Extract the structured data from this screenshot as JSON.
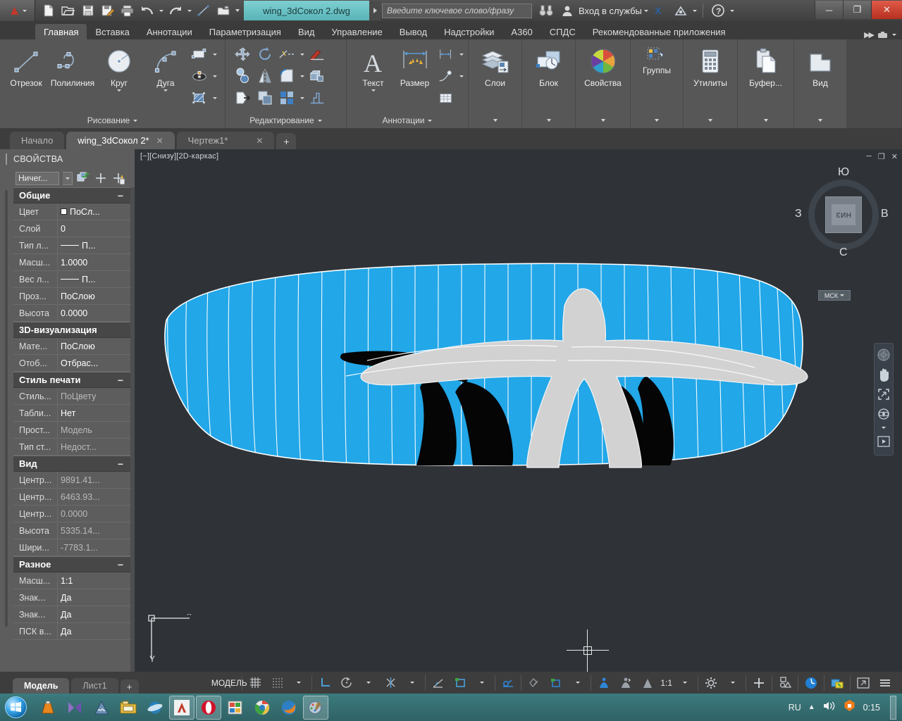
{
  "titlebar": {
    "app_logo": "autocad-a-logo",
    "quick_access": [
      {
        "name": "new-file-icon",
        "label": "Создать"
      },
      {
        "name": "open-folder-icon",
        "label": "Открыть"
      },
      {
        "name": "save-icon",
        "label": "Сохранить"
      },
      {
        "name": "save-as-icon",
        "label": "Сохранить как"
      },
      {
        "name": "print-icon",
        "label": "Печать"
      },
      {
        "name": "undo-icon",
        "label": "Отменить"
      },
      {
        "name": "redo-icon",
        "label": "Повторить"
      },
      {
        "name": "line-tool-icon",
        "label": "Отрезок"
      },
      {
        "name": "workspace-icon",
        "label": "Рабочее пространство"
      }
    ],
    "document_title": "wing_3dСокол 2.dwg",
    "search_placeholder": "Введите ключевое слово/фразу",
    "binoculars_icon": "binoculars-icon",
    "user_icon": "user-icon",
    "signin_label": "Вход в службы",
    "exchange_icon": "autodesk-exchange-icon",
    "a360_icon": "autodesk-a360-icon",
    "help_label": "?",
    "window_buttons": {
      "minimize": "─",
      "maximize": "❐",
      "close": "✕"
    }
  },
  "ribbon_tabs": [
    {
      "label": "Главная",
      "active": true
    },
    {
      "label": "Вставка",
      "active": false
    },
    {
      "label": "Аннотации",
      "active": false
    },
    {
      "label": "Параметризация",
      "active": false
    },
    {
      "label": "Вид",
      "active": false
    },
    {
      "label": "Управление",
      "active": false
    },
    {
      "label": "Вывод",
      "active": false
    },
    {
      "label": "Надстройки",
      "active": false
    },
    {
      "label": "A360",
      "active": false
    },
    {
      "label": "СПДС",
      "active": false
    },
    {
      "label": "Рекомендованные приложения",
      "active": false
    }
  ],
  "ribbon_panels": {
    "draw": {
      "title": "Рисование",
      "buttons": [
        {
          "label": "Отрезок",
          "icon": "line-icon",
          "dropdown": false
        },
        {
          "label": "Полилиния",
          "icon": "polyline-icon",
          "dropdown": false
        },
        {
          "label": "Круг",
          "icon": "circle-icon",
          "dropdown": true
        },
        {
          "label": "Дуга",
          "icon": "arc-icon",
          "dropdown": true
        }
      ],
      "small_buttons": [
        {
          "icon": "rectangle-icon",
          "dropdown": true
        },
        {
          "icon": "ellipse-icon",
          "dropdown": true
        },
        {
          "icon": "hatch-icon",
          "dropdown": true
        }
      ]
    },
    "modify": {
      "title": "Редактирование",
      "small_buttons": [
        {
          "icon": "move-icon",
          "dropdown": false
        },
        {
          "icon": "rotate-icon",
          "dropdown": false
        },
        {
          "icon": "trim-icon",
          "dropdown": true
        },
        {
          "icon": "match-properties-icon",
          "dropdown": false
        },
        {
          "icon": "copy-icon",
          "dropdown": false
        },
        {
          "icon": "mirror-icon",
          "dropdown": false
        },
        {
          "icon": "fillet-icon",
          "dropdown": true
        },
        {
          "icon": "3d-array-icon",
          "dropdown": false
        },
        {
          "icon": "stretch-icon",
          "dropdown": false
        },
        {
          "icon": "scale-icon",
          "dropdown": false
        },
        {
          "icon": "array-icon",
          "dropdown": true
        },
        {
          "icon": "extrude-icon",
          "dropdown": false
        }
      ]
    },
    "annotation": {
      "title": "Аннотации",
      "buttons": [
        {
          "label": "Текст",
          "icon": "text-a-icon",
          "dropdown": true
        },
        {
          "label": "Размер",
          "icon": "dimension-icon",
          "dropdown": false
        }
      ],
      "small_buttons": [
        {
          "icon": "dimension-linear-icon",
          "dropdown": true
        },
        {
          "icon": "leader-icon",
          "dropdown": true
        },
        {
          "icon": "table-icon",
          "dropdown": false
        }
      ]
    },
    "large_panels": [
      {
        "label": "Слои",
        "icon": "layers-icon",
        "title": ""
      },
      {
        "label": "Блок",
        "icon": "block-icon",
        "title": ""
      },
      {
        "label": "Свойства",
        "icon": "properties-wheel-icon",
        "title": ""
      },
      {
        "label": "Группы",
        "icon": "groups-icon",
        "title": ""
      },
      {
        "label": "Утилиты",
        "icon": "utilities-calculator-icon",
        "title": ""
      },
      {
        "label": "Буфер...",
        "icon": "clipboard-icon",
        "title": ""
      },
      {
        "label": "Вид",
        "icon": "view-icon",
        "title": ""
      }
    ]
  },
  "file_tabs": [
    {
      "label": "Начало",
      "active": false,
      "closable": false
    },
    {
      "label": "wing_3dСокол 2*",
      "active": true,
      "closable": true
    },
    {
      "label": "Чертеж1*",
      "active": false,
      "closable": true
    }
  ],
  "file_tab_add": "+",
  "properties": {
    "title": "СВОЙСТВА",
    "selection": "Ничег...",
    "toolbar_icons": [
      "quick-select-icon",
      "pick-point-icon",
      "quick-calc-icon"
    ],
    "groups": [
      {
        "name": "Общие",
        "collapse": "−",
        "rows": [
          {
            "key": "Цвет",
            "value": "ПоСл...",
            "swatch": true,
            "dim": false
          },
          {
            "key": "Слой",
            "value": "0",
            "dim": false
          },
          {
            "key": "Тип л...",
            "value": "П...",
            "linetype": true,
            "dim": false
          },
          {
            "key": "Масш...",
            "value": "1.0000",
            "dim": false
          },
          {
            "key": "Вес л...",
            "value": "П...",
            "linetype": true,
            "dim": false
          },
          {
            "key": "Проз...",
            "value": "ПоСлою",
            "dim": false
          },
          {
            "key": "Высота",
            "value": "0.0000",
            "dim": false
          }
        ]
      },
      {
        "name": "3D-визуализация",
        "collapse": "",
        "rows": [
          {
            "key": "Мате...",
            "value": "ПоСлою",
            "dim": false
          },
          {
            "key": "Отоб...",
            "value": "Отбрас...",
            "dim": false
          }
        ]
      },
      {
        "name": "Стиль печати",
        "collapse": "−",
        "rows": [
          {
            "key": "Стиль...",
            "value": "ПоЦвету",
            "dim": true
          },
          {
            "key": "Табли...",
            "value": "Нет",
            "dim": false
          },
          {
            "key": "Прост...",
            "value": "Модель",
            "dim": true
          },
          {
            "key": "Тип ст...",
            "value": "Недост...",
            "dim": true
          }
        ]
      },
      {
        "name": "Вид",
        "collapse": "−",
        "rows": [
          {
            "key": "Центр...",
            "value": "9891.41...",
            "dim": true
          },
          {
            "key": "Центр...",
            "value": "6463.93...",
            "dim": true
          },
          {
            "key": "Центр...",
            "value": "0.0000",
            "dim": true
          },
          {
            "key": "Высота",
            "value": "5335.14...",
            "dim": true
          },
          {
            "key": "Шири...",
            "value": "-7783.1...",
            "dim": true
          }
        ]
      },
      {
        "name": "Разное",
        "collapse": "−",
        "rows": [
          {
            "key": "Масш...",
            "value": "1:1",
            "dim": false
          },
          {
            "key": "Знак...",
            "value": "Да",
            "dim": false
          },
          {
            "key": "Знак...",
            "value": "Да",
            "dim": false
          },
          {
            "key": "ПСК в...",
            "value": "Да",
            "dim": false
          }
        ]
      }
    ]
  },
  "viewport": {
    "label": "[−][Снизу][2D-каркас]",
    "window_buttons": [
      "─",
      "❐",
      "✕"
    ],
    "viewcube": {
      "top": "Ю",
      "bottom": "С",
      "left": "З",
      "right": "В",
      "face": "НИЗ",
      "wcs": "МСК"
    },
    "navbar_icons": [
      "full-navigation-wheel-icon",
      "pan-hand-icon",
      "zoom-extents-icon",
      "orbit-icon",
      "show-motion-icon"
    ],
    "colors": {
      "background": "#2f3338",
      "wing_fill": "#22a7e8",
      "body_fill": "#d2d2d2",
      "shadow_fill": "#000000",
      "outline": "#ffffff"
    },
    "drawing_name": "wing-3d-falcon-plan-view"
  },
  "status_bar": {
    "model_tabs": [
      {
        "label": "Модель",
        "active": true
      },
      {
        "label": "Лист1",
        "active": false
      }
    ],
    "add_layout": "+",
    "space_label": "МОДЕЛЬ",
    "toggles": [
      {
        "name": "grid-display-icon",
        "dropdown": false
      },
      {
        "name": "snap-mode-icon",
        "dropdown": true
      },
      {
        "name": "ortho-mode-icon",
        "dropdown": false
      },
      {
        "name": "polar-tracking-icon",
        "dropdown": true
      },
      {
        "name": "object-snap-icon",
        "dropdown": true
      },
      {
        "name": "object-snap-tracking-icon",
        "dropdown": false
      },
      {
        "name": "dynamic-ucs-icon",
        "dropdown": true
      },
      {
        "name": "lineweight-icon",
        "dropdown": false
      },
      {
        "name": "transparency-icon",
        "dropdown": false
      },
      {
        "name": "selection-cycling-icon",
        "dropdown": false
      }
    ],
    "annotation_scale": "1:1",
    "right_icons": [
      "workspace-gear-icon",
      "customization-plus-icon",
      "isolate-objects-icon",
      "graphics-performance-icon",
      "hardware-acceleration-icon",
      "clean-screen-icon",
      "customization-menu-icon"
    ]
  },
  "taskbar": {
    "start": "windows-start-orb",
    "items": [
      {
        "name": "vlc-icon",
        "pinned": true
      },
      {
        "name": "media-player-icon",
        "pinned": true
      },
      {
        "name": "audacity-icon",
        "pinned": true
      },
      {
        "name": "file-explorer-icon",
        "pinned": true
      },
      {
        "name": "internet-explorer-icon",
        "pinned": true
      },
      {
        "name": "autocad-icon",
        "pinned": false,
        "running": true
      },
      {
        "name": "opera-icon",
        "pinned": false,
        "running": true
      },
      {
        "name": "office-icon",
        "pinned": true
      },
      {
        "name": "chrome-icon",
        "pinned": true
      },
      {
        "name": "firefox-icon",
        "pinned": true
      },
      {
        "name": "paint-icon",
        "pinned": false,
        "running": true
      }
    ],
    "tray": {
      "language": "RU",
      "show_hidden": "▲",
      "volume_icon": "volume-icon",
      "antivirus_icon": "avast-icon",
      "clock": "0:15"
    }
  }
}
